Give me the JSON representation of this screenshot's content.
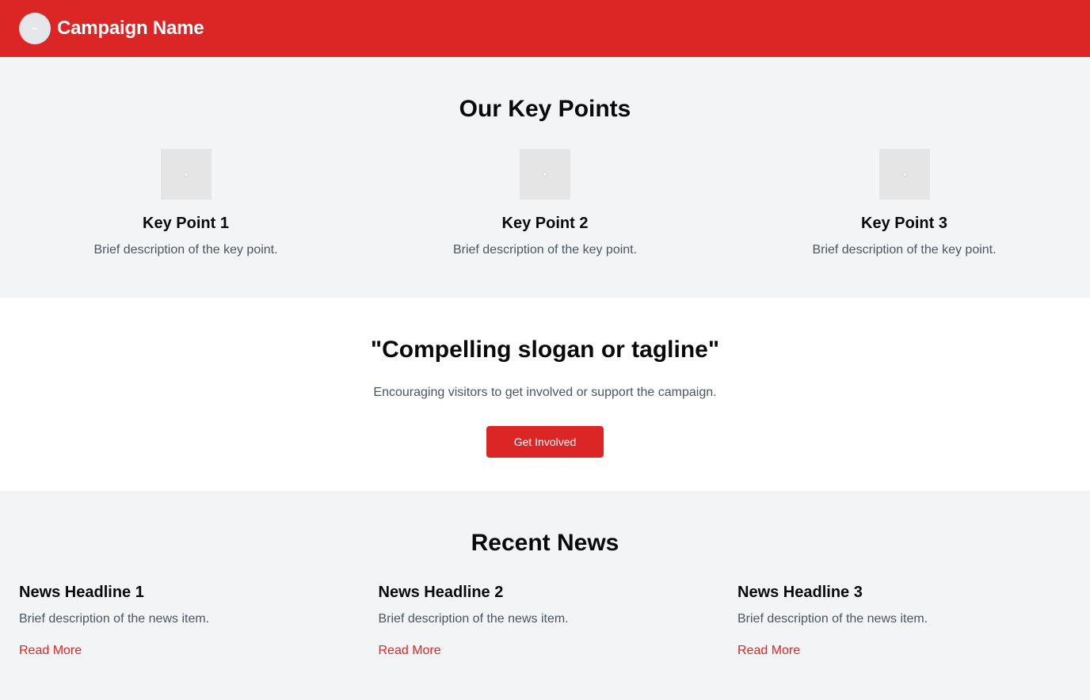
{
  "header": {
    "campaign_name": "Campaign Name",
    "logo_icon": "circle-logo-placeholder"
  },
  "key_points": {
    "title": "Our Key Points",
    "items": [
      {
        "title": "Key Point 1",
        "description": "Brief description of the key point.",
        "icon": "image-placeholder-icon"
      },
      {
        "title": "Key Point 2",
        "description": "Brief description of the key point.",
        "icon": "image-placeholder-icon"
      },
      {
        "title": "Key Point 3",
        "description": "Brief description of the key point.",
        "icon": "image-placeholder-icon"
      }
    ]
  },
  "cta": {
    "slogan": "\"Compelling slogan or tagline\"",
    "subtitle": "Encouraging visitors to get involved or support the campaign.",
    "button_label": "Get Involved"
  },
  "news": {
    "title": "Recent News",
    "items": [
      {
        "headline": "News Headline 1",
        "description": "Brief description of the news item.",
        "link_label": "Read More"
      },
      {
        "headline": "News Headline 2",
        "description": "Brief description of the news item.",
        "link_label": "Read More"
      },
      {
        "headline": "News Headline 3",
        "description": "Brief description of the news item.",
        "link_label": "Read More"
      }
    ]
  },
  "colors": {
    "brand_red": "#dc2626",
    "section_gray": "#f3f4f6",
    "text_muted": "#4b5563"
  }
}
